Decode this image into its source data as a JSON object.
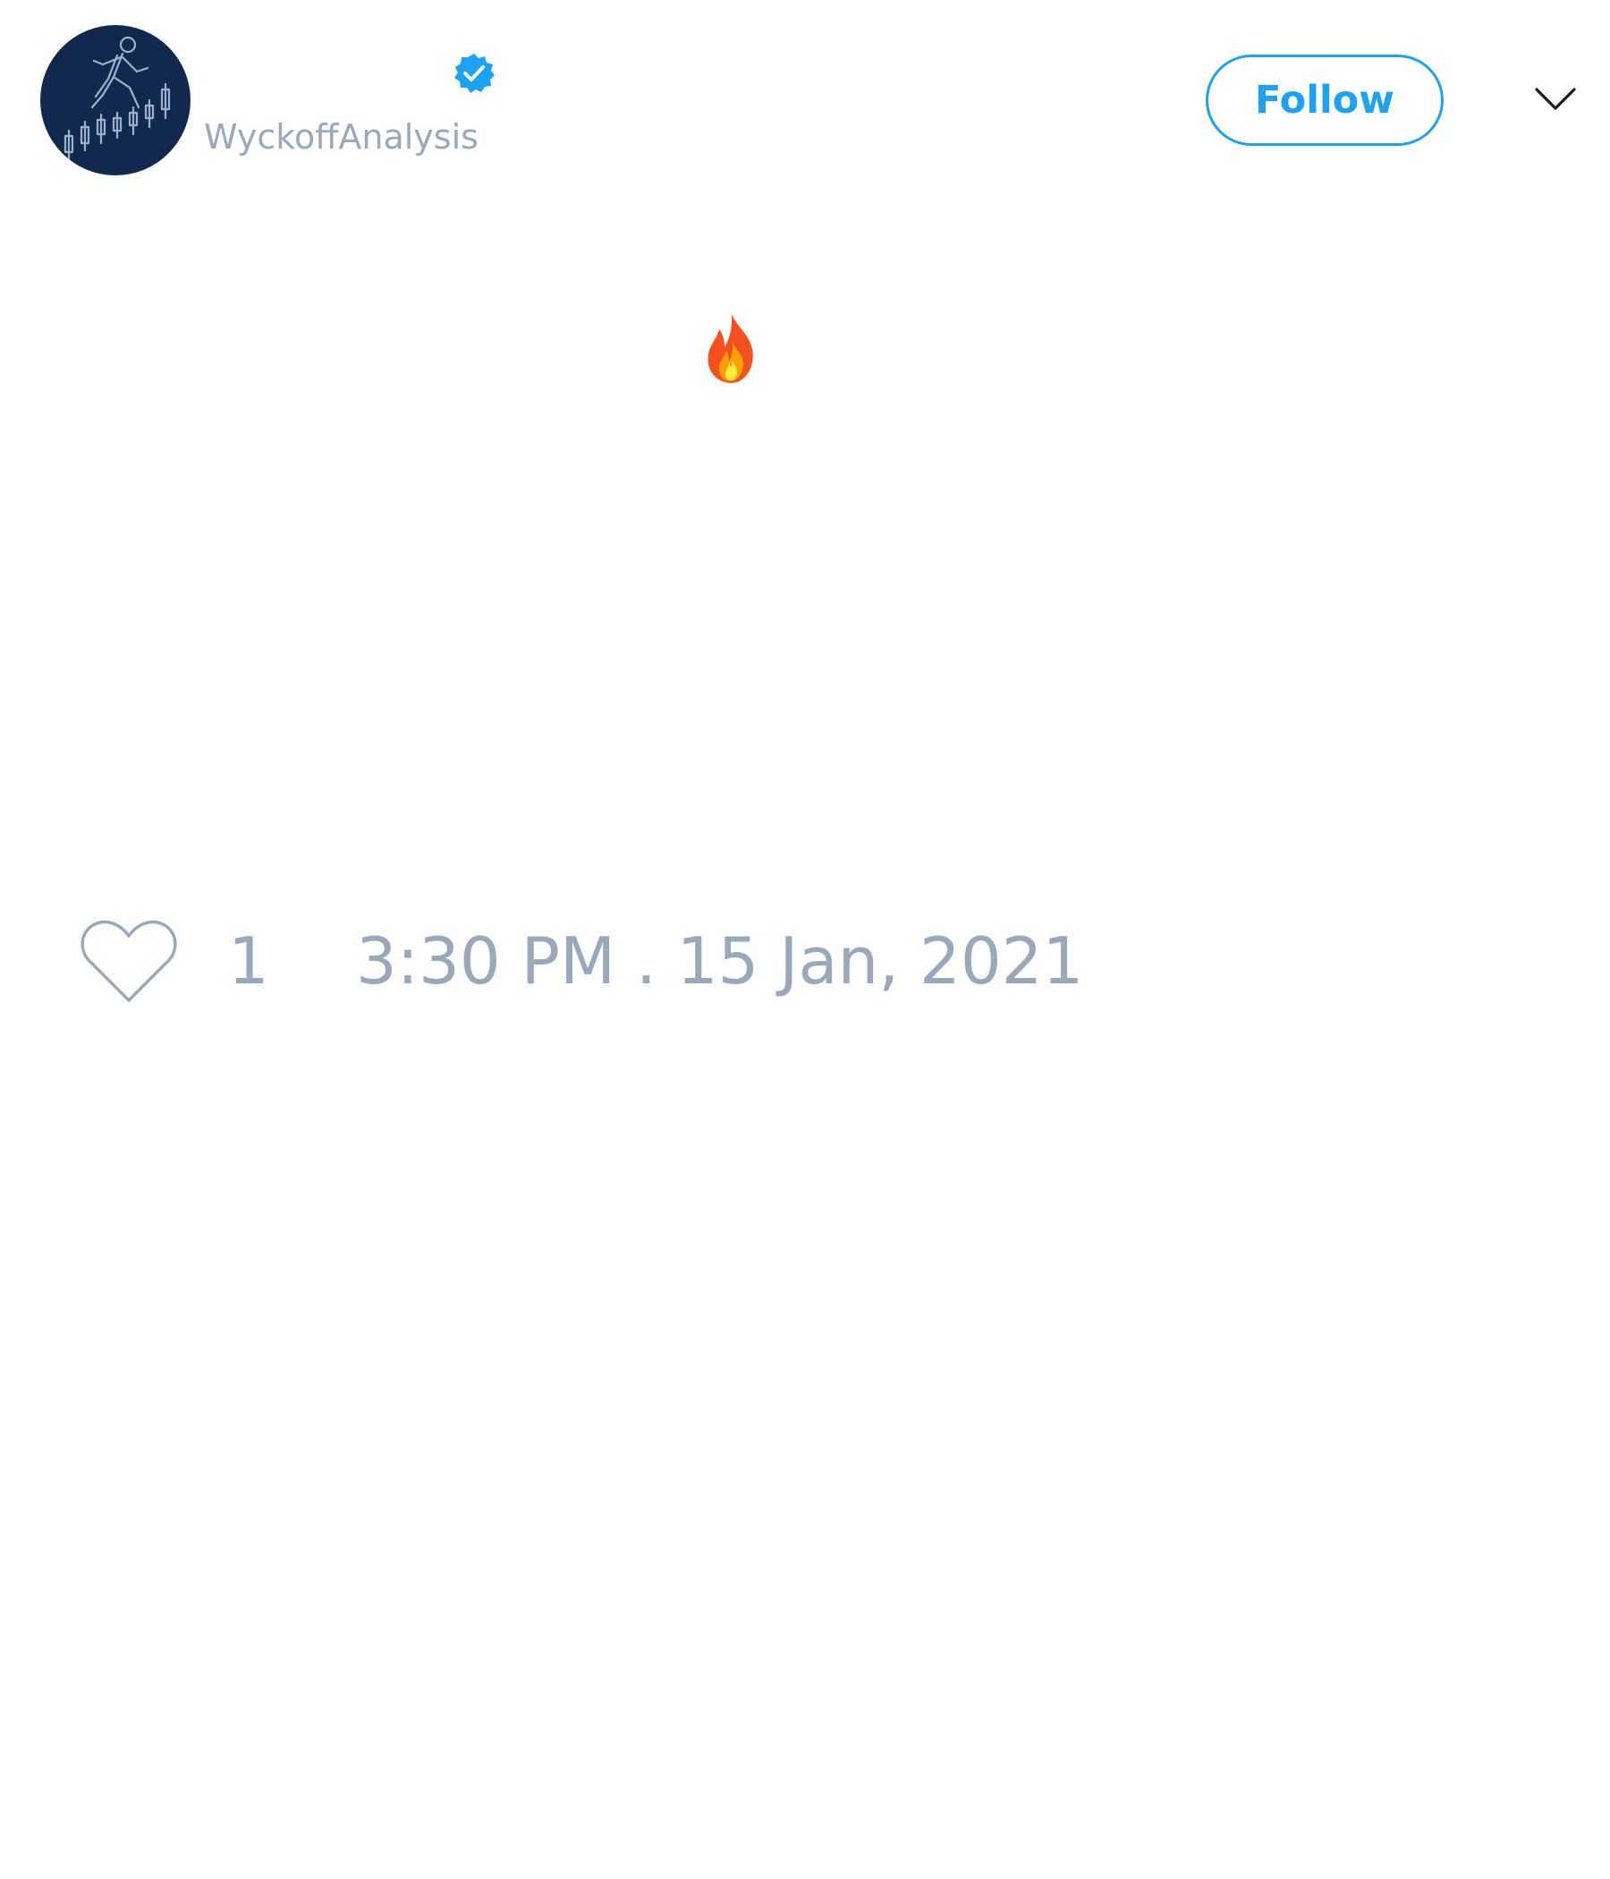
{
  "user": {
    "handle": "WyckoffAnalysis",
    "verified": true,
    "avatar_icon": "wyckoff-runner-logo"
  },
  "header": {
    "follow_label": "Follow",
    "menu_icon": "chevron-down-icon"
  },
  "tweet": {
    "emoji": "fire-emoji",
    "like_count": "1",
    "timestamp": "3:30 PM . 15 Jan, 2021"
  },
  "colors": {
    "accent": "#1da1f2",
    "muted_text": "#9aa8bb",
    "avatar_bg": "#12294f",
    "background": "#ffffff"
  }
}
